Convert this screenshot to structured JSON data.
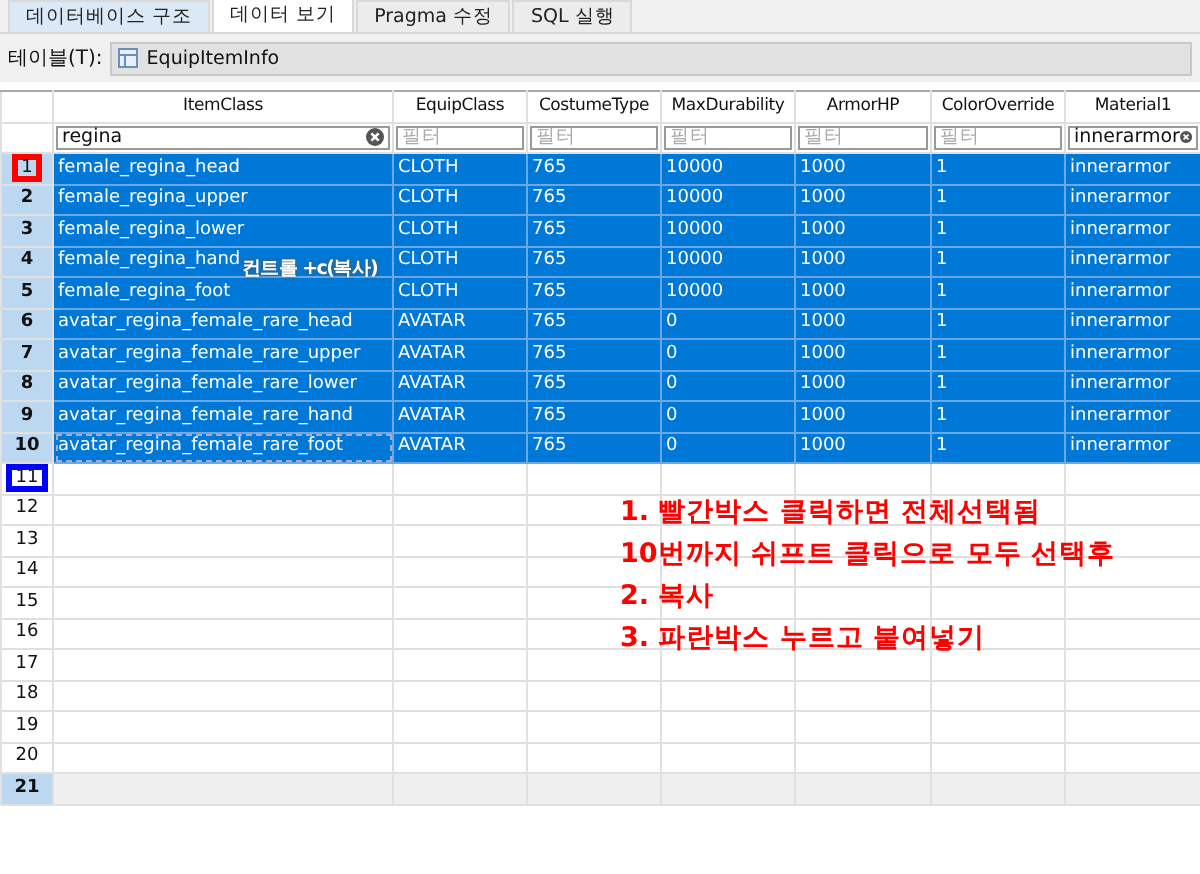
{
  "tabs": [
    {
      "label": "데이터베이스 구조",
      "selected": false
    },
    {
      "label": "데이터 보기",
      "selected": true
    },
    {
      "label": "Pragma 수정",
      "selected": false
    },
    {
      "label": "SQL 실행",
      "selected": false
    }
  ],
  "table_picker": {
    "label": "테이블(T):",
    "value": "EquipItemInfo"
  },
  "table": {
    "columns": [
      {
        "name": "ItemClass",
        "filter": {
          "value": "regina"
        }
      },
      {
        "name": "EquipClass",
        "filter": {
          "placeholder": "필터"
        }
      },
      {
        "name": "CostumeType",
        "filter": {
          "placeholder": "필터"
        }
      },
      {
        "name": "MaxDurability",
        "filter": {
          "placeholder": "필터"
        }
      },
      {
        "name": "ArmorHP",
        "filter": {
          "placeholder": "필터"
        }
      },
      {
        "name": "ColorOverride",
        "filter": {
          "placeholder": "필터"
        }
      },
      {
        "name": "Material1",
        "filter": {
          "value": "innerarmor"
        }
      }
    ],
    "rows": [
      {
        "number": "1",
        "selected": true,
        "color": "#ff0000",
        "cells": [
          "female_regina_head",
          "CLOTH",
          "765",
          "10000",
          "1000",
          "1",
          "innerarmor"
        ]
      },
      {
        "number": "2",
        "selected": true,
        "cells": [
          "female_regina_upper",
          "CLOTH",
          "765",
          "10000",
          "1000",
          "1",
          "innerarmor"
        ]
      },
      {
        "number": "3",
        "selected": true,
        "cells": [
          "female_regina_lower",
          "CLOTH",
          "765",
          "10000",
          "1000",
          "1",
          "innerarmor"
        ]
      },
      {
        "number": "4",
        "selected": true,
        "cells": [
          "female_regina_hand",
          "CLOTH",
          "765",
          "10000",
          "1000",
          "1",
          "innerarmor"
        ]
      },
      {
        "number": "5",
        "selected": true,
        "cells": [
          "female_regina_foot",
          "CLOTH",
          "765",
          "10000",
          "1000",
          "1",
          "innerarmor"
        ]
      },
      {
        "number": "6",
        "selected": true,
        "cells": [
          "avatar_regina_female_rare_head",
          "AVATAR",
          "765",
          "0",
          "1000",
          "1",
          "innerarmor"
        ]
      },
      {
        "number": "7",
        "selected": true,
        "cells": [
          "avatar_regina_female_rare_upper",
          "AVATAR",
          "765",
          "0",
          "1000",
          "1",
          "innerarmor"
        ]
      },
      {
        "number": "8",
        "selected": true,
        "cells": [
          "avatar_regina_female_rare_lower",
          "AVATAR",
          "765",
          "0",
          "1000",
          "1",
          "innerarmor"
        ]
      },
      {
        "number": "9",
        "selected": true,
        "cells": [
          "avatar_regina_female_rare_hand",
          "AVATAR",
          "765",
          "0",
          "1000",
          "1",
          "innerarmor"
        ]
      },
      {
        "number": "10",
        "selected": true,
        "focused": true,
        "cells": [
          "avatar_regina_female_rare_foot",
          "AVATAR",
          "765",
          "0",
          "1000",
          "1",
          "innerarmor"
        ]
      },
      {
        "number": "11",
        "selected": false,
        "color": "#0000ff",
        "cells": []
      },
      {
        "number": "12",
        "selected": false,
        "cells": []
      },
      {
        "number": "13",
        "selected": false,
        "cells": []
      },
      {
        "number": "14",
        "selected": false,
        "cells": []
      },
      {
        "number": "15",
        "selected": false,
        "cells": []
      },
      {
        "number": "16",
        "selected": false,
        "cells": []
      },
      {
        "number": "17",
        "selected": false,
        "cells": []
      },
      {
        "number": "18",
        "selected": false,
        "cells": []
      },
      {
        "number": "19",
        "selected": false,
        "cells": []
      },
      {
        "number": "20",
        "selected": false,
        "cells": []
      },
      {
        "number": "21",
        "selected": false,
        "kind": "new",
        "cells": []
      }
    ]
  },
  "annotations": [
    {
      "kind": "overlay",
      "text": "컨트롤 +c(복사)"
    },
    {
      "kind": "note",
      "lines": [
        "1. 빨간박스 클릭하면 전체선택됨",
        "10번까지 쉬프트 클릭으로 모두 선택후",
        "2. 복사",
        "3. 파란박스 누르고 붙여넣기"
      ]
    }
  ]
}
